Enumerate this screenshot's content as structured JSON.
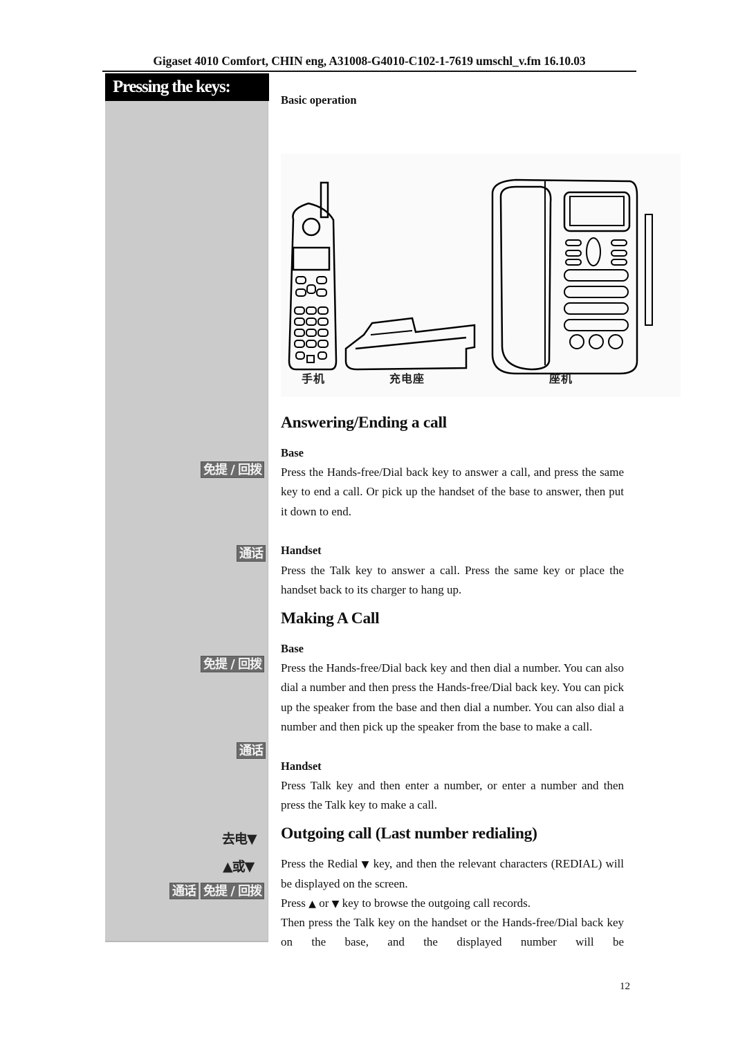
{
  "document": {
    "header": "Gigaset 4010 Comfort, CHIN eng, A31008-G4010-C102-1-7619 umschl_v.fm 16.10.03",
    "page_number": "12"
  },
  "sidebar": {
    "title": "Pressing the keys:",
    "keys": {
      "handsfree_dialback_1": "免提 / 回拨",
      "talk_1": "通话",
      "handsfree_dialback_2": "免提 / 回拨",
      "talk_2": "通话",
      "redial": "去电▼",
      "up_or_down": "▲或▼",
      "talk_3": "通话",
      "handsfree_dialback_3": "免提 / 回拨"
    }
  },
  "main": {
    "section_title": "Basic operation",
    "figure": {
      "captions": [
        "手机",
        "充电座",
        "座机"
      ],
      "items": [
        "handset",
        "charger",
        "base-unit"
      ]
    },
    "sections": [
      {
        "heading": "Answering/Ending a call",
        "blocks": [
          {
            "label": "Base",
            "text": "Press the Hands-free/Dial back key to answer a call, and press the same key to end a call. Or pick up the handset of the base to answer, then put it down to end."
          },
          {
            "label": "Handset",
            "text": "Press the Talk key to answer a call. Press the same key or place the handset back to its charger to hang up."
          }
        ]
      },
      {
        "heading": "Making A Call",
        "blocks": [
          {
            "label": "Base",
            "text": "Press the Hands-free/Dial back key and then dial a number. You can also dial a number and then press the Hands-free/Dial back key. You can pick up the speaker from the base and then dial a number. You can also dial a number and then pick up the speaker from the base to make a call."
          },
          {
            "label": "Handset",
            "text": "Press Talk key and then enter a number, or enter a number and then press the Talk key to make a call."
          }
        ]
      },
      {
        "heading": "Outgoing call (Last number redialing)",
        "lines": [
          {
            "pre": "Press the Redial",
            "tri": "▼",
            "post": "key, and then the relevant characters (REDIAL) will be displayed on the screen."
          },
          {
            "pre": "Press",
            "tri1": "▲",
            "mid": "or",
            "tri2": "▼",
            "post": "key to browse the outgoing call records."
          },
          {
            "text": "Then press the Talk key on the handset or the Hands-free/Dial back key on the base, and the displayed number will be"
          }
        ]
      }
    ]
  }
}
